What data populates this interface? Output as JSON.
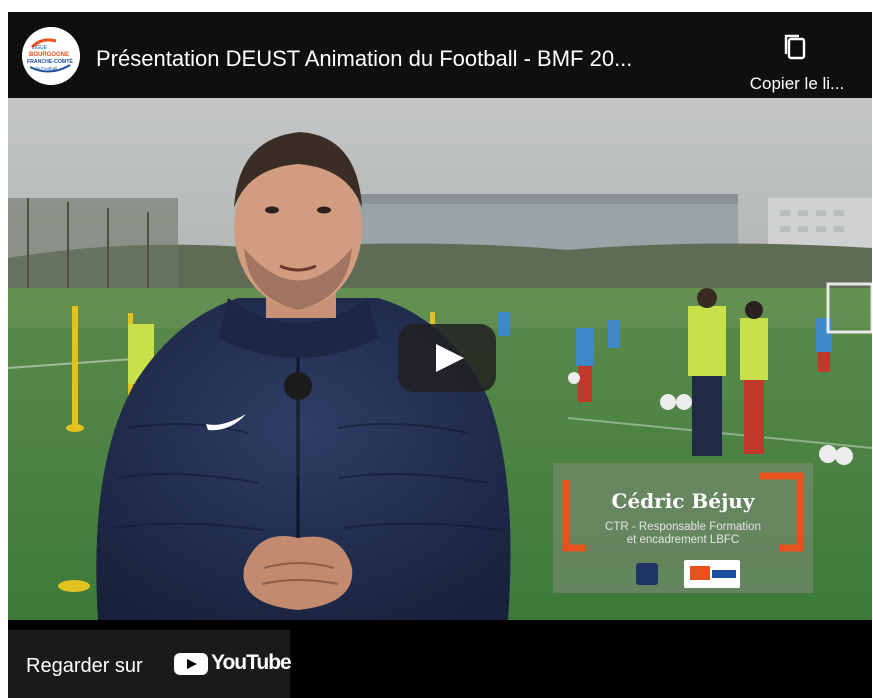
{
  "header": {
    "title": "Présentation DEUST Animation du Football - BMF 20...",
    "channel_logo_text": [
      "LIGUE",
      "BOURGOGNE",
      "FRANCHE-COMTÉ",
      "de Football"
    ],
    "copy_label": "Copier le li..."
  },
  "video": {
    "lower_third": {
      "name": "Cédric Béjuy",
      "role_line1": "CTR - Responsable Formation",
      "role_line2": "et encadrement LBFC"
    }
  },
  "footer": {
    "watch_label": "Regarder sur",
    "youtube_word": "YouTube"
  },
  "colors": {
    "play_button": "#212121",
    "youtube_red": "#ff0000",
    "accent_orange": "#e8501c"
  },
  "icons": {
    "copy": "copy-icon",
    "play": "play-icon",
    "youtube": "youtube-logo-icon"
  }
}
